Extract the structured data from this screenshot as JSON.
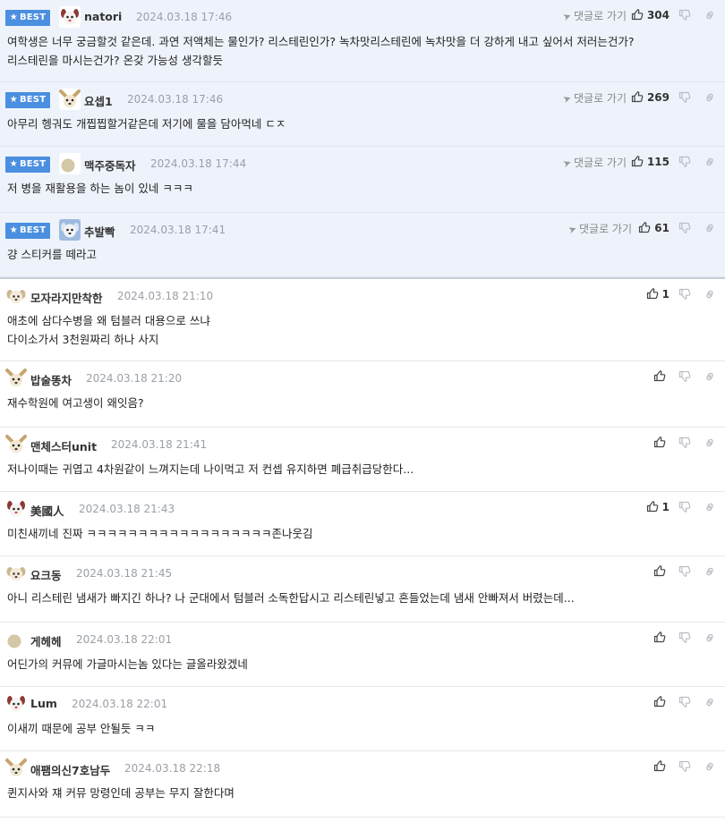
{
  "ui": {
    "best_label": "BEST",
    "goto_label": "댓글로 가기"
  },
  "colors": {
    "best_bg": "#eef3fb",
    "badge": "#4a8fe0",
    "date": "#9aa0a7"
  },
  "comments": [
    {
      "best": true,
      "nick": "natori",
      "date": "2024.03.18 17:46",
      "likes": "304",
      "avatar": "dog-white",
      "lines": [
        "여학생은 너무 궁금할것 같은데. 과연 저액체는 물인가? 리스테린인가? 녹차맛리스테린에 녹차맛을 더 강하게 내고 싶어서 저러는건가?",
        "리스테린을 마시는건가? 온갖 가능성 생각할듯"
      ]
    },
    {
      "best": true,
      "nick": "요셉1",
      "date": "2024.03.18 17:46",
      "likes": "269",
      "avatar": "dog-chihuahua",
      "lines": [
        "아무리 헹궈도 개찝찝할거같은데 저기에 물을 담아먹네 ㄷㅈ"
      ]
    },
    {
      "best": true,
      "nick": "맥주중독자",
      "date": "2024.03.18 17:44",
      "likes": "115",
      "avatar": "dot",
      "lines": [
        "저 병을 재활용을 하는 놈이 있네 ㅋㅋㅋ"
      ]
    },
    {
      "best": true,
      "nick": "추발빡",
      "date": "2024.03.18 17:41",
      "likes": "61",
      "avatar": "dog-blue",
      "lines": [
        "걍 스티커를 떼라고"
      ]
    },
    {
      "best": false,
      "nick": "모자라지만착한",
      "date": "2024.03.18 21:10",
      "likes": "1",
      "avatar": "dog-pup",
      "lines": [
        "애초에 삼다수병을 왜 텀블러 대용으로 쓰냐",
        "다이소가서 3천원짜리 하나 사지"
      ]
    },
    {
      "best": false,
      "nick": "밥술똥차",
      "date": "2024.03.18 21:20",
      "likes": "",
      "avatar": "dog-chihuahua",
      "lines": [
        "재수학원에 여고생이 왜잇음?"
      ]
    },
    {
      "best": false,
      "nick": "맨체스터unit",
      "date": "2024.03.18 21:41",
      "likes": "",
      "avatar": "dog-chihuahua",
      "lines": [
        "저나이때는 귀엽고 4차원같이 느껴지는데 나이먹고 저 컨셉 유지하면 폐급취급당한다..."
      ]
    },
    {
      "best": false,
      "nick": "美國人",
      "date": "2024.03.18 21:43",
      "likes": "1",
      "avatar": "dog-white",
      "lines": [
        "미친새끼네 진짜 ㅋㅋㅋㅋㅋㅋㅋㅋㅋㅋㅋㅋㅋㅋㅋㅋㅋㅋ존나웃김"
      ]
    },
    {
      "best": false,
      "nick": "요크동",
      "date": "2024.03.18 21:45",
      "likes": "",
      "avatar": "dog-pup",
      "lines": [
        "아니 리스테린 냄새가 빠지긴 하나? 나 군대에서 텀블러 소독한답시고 리스테린넣고 흔들었는데 냄새 안빠져서 버렸는데..."
      ]
    },
    {
      "best": false,
      "nick": "게헤헤",
      "date": "2024.03.18 22:01",
      "likes": "",
      "avatar": "dot",
      "lines": [
        "어딘가의 커뮤에 가글마시는놈 있다는 글올라왔겠네"
      ]
    },
    {
      "best": false,
      "nick": "Lum",
      "date": "2024.03.18 22:01",
      "likes": "",
      "avatar": "dog-white",
      "lines": [
        "이새끼 때문에 공부 안될듯 ㅋㅋ"
      ]
    },
    {
      "best": false,
      "nick": "애팸의신7호남두",
      "date": "2024.03.18 22:18",
      "likes": "",
      "avatar": "dog-chihuahua",
      "lines": [
        "퀸지사와 쟤 커뮤 망령인데 공부는 무지 잘한다며"
      ]
    }
  ]
}
